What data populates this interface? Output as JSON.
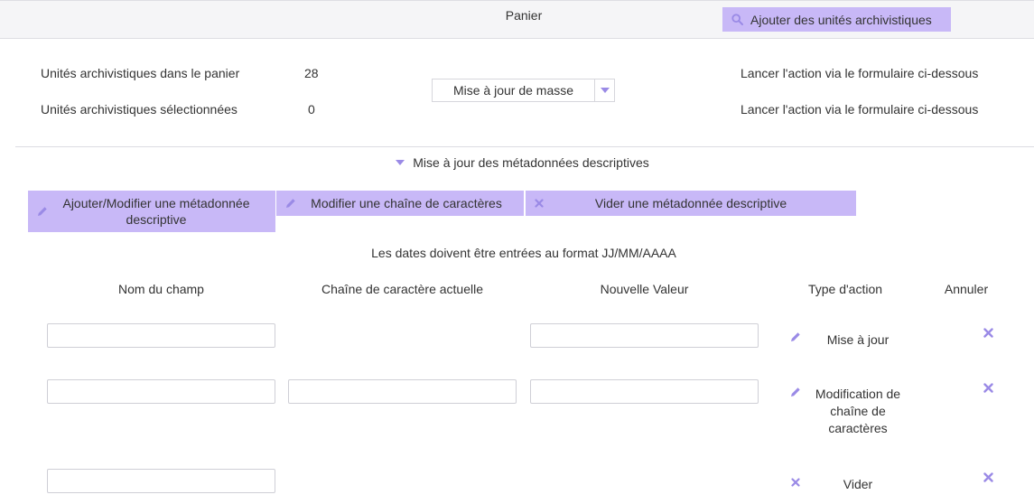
{
  "header": {
    "title": "Panier",
    "add_button_label": "Ajouter des unités archivistiques"
  },
  "summary": {
    "in_basket_label": "Unités archivistiques dans le panier",
    "in_basket_count": "28",
    "selected_label": "Unités archivistiques sélectionnées",
    "selected_count": "0",
    "action_select_value": "Mise à jour de masse",
    "launch_text_1": "Lancer l'action via le formulaire ci-dessous",
    "launch_text_2": "Lancer l'action via le formulaire ci-dessous"
  },
  "section": {
    "title": "Mise à jour des métadonnées descriptives"
  },
  "tabs": [
    {
      "label": "Ajouter/Modifier une métadonnée descriptive",
      "icon": "pencil-icon"
    },
    {
      "label": "Modifier une chaîne de caractères",
      "icon": "pencil-icon"
    },
    {
      "label": "Vider une métadonnée descriptive",
      "icon": "x-icon"
    }
  ],
  "date_note": "Les dates doivent être entrées au format JJ/MM/AAAA",
  "columns": {
    "field_name": "Nom du champ",
    "current_string": "Chaîne de caractère actuelle",
    "new_value": "Nouvelle Valeur",
    "action_type": "Type d'action",
    "cancel": "Annuler"
  },
  "rows": [
    {
      "action_label": "Mise à jour",
      "action_icon": "pencil-icon",
      "field_value": "",
      "current_value": "",
      "new_value": ""
    },
    {
      "action_label": "Modification de chaîne de caractères",
      "action_icon": "pencil-icon",
      "field_value": "",
      "current_value": "",
      "new_value": ""
    },
    {
      "action_label": "Vider",
      "action_icon": "x-icon",
      "field_value": ""
    }
  ],
  "colors": {
    "accent": "#c8b8f7",
    "icon": "#9a8ae6",
    "header_bg": "#f5f5f7",
    "text": "#333333"
  }
}
